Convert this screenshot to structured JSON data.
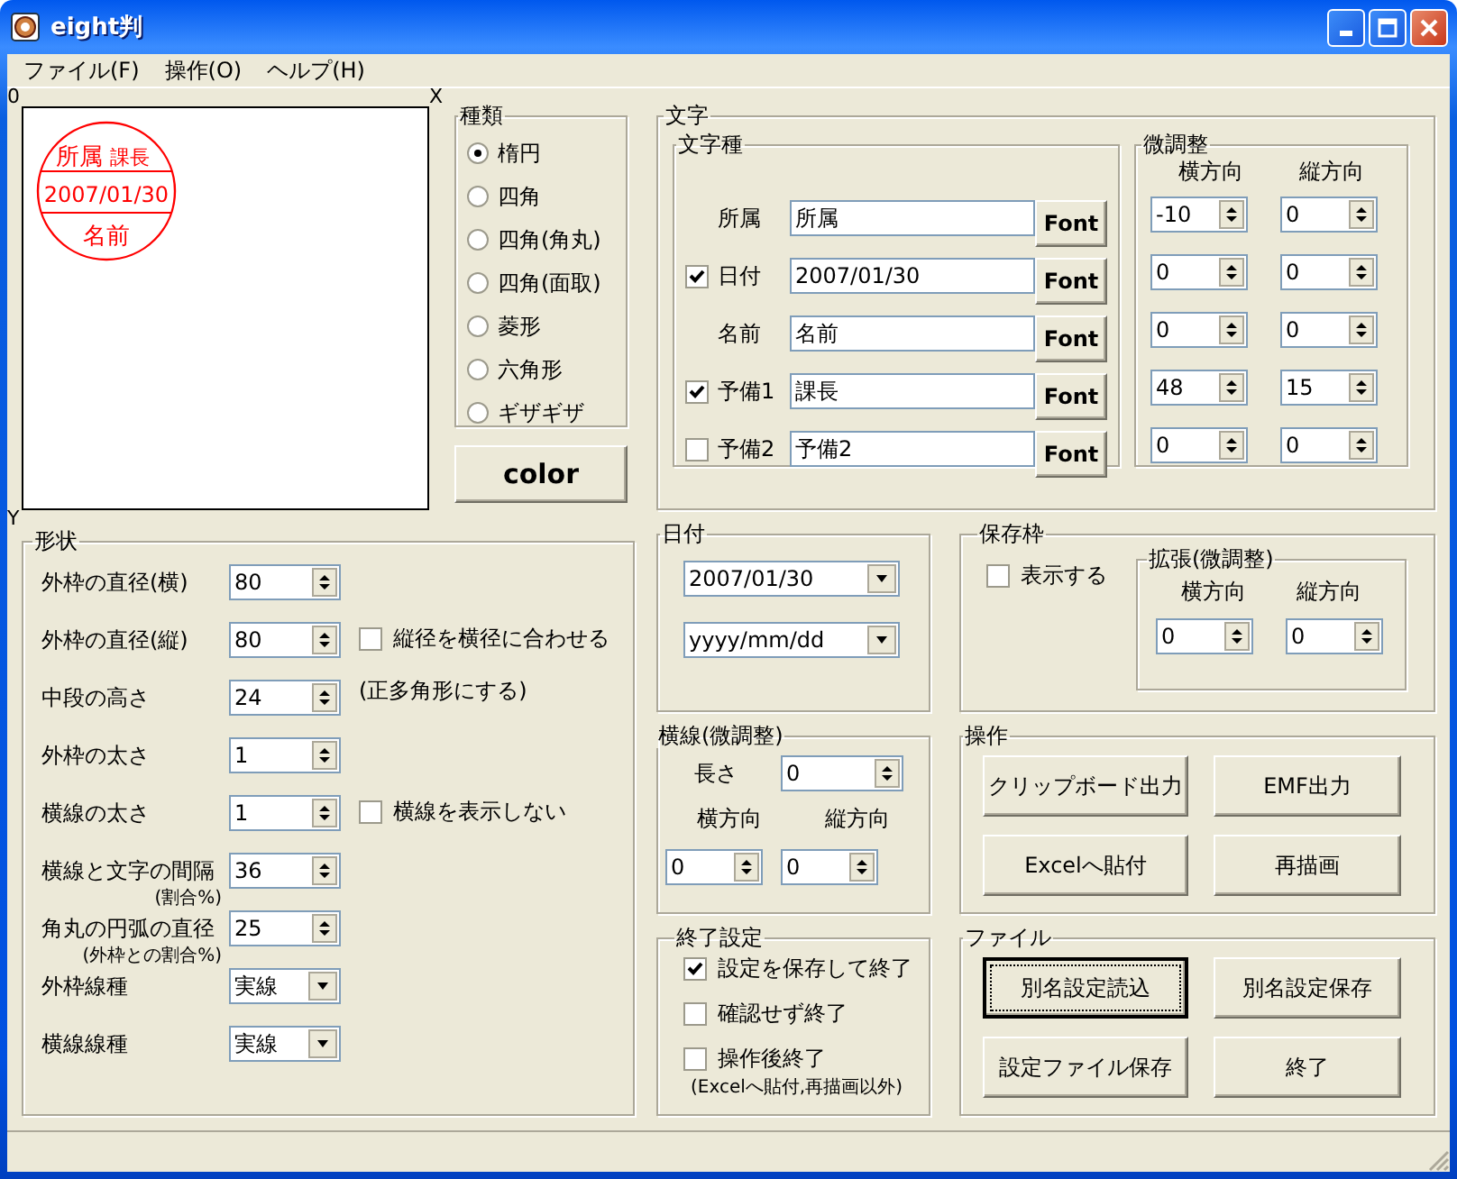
{
  "window": {
    "title": "eight判"
  },
  "menu": [
    "ファイル(F)",
    "操作(O)",
    "ヘルプ(H)"
  ],
  "preview": {
    "origin_label": "0",
    "x_label": "X",
    "y_label": "Y",
    "stamp": {
      "top": "所属",
      "top_extra": "課長",
      "middle": "2007/01/30",
      "bottom": "名前"
    }
  },
  "shape_type": {
    "title": "種類",
    "options": [
      {
        "label": "楕円",
        "selected": true
      },
      {
        "label": "四角",
        "selected": false
      },
      {
        "label": "四角(角丸)",
        "selected": false
      },
      {
        "label": "四角(面取)",
        "selected": false
      },
      {
        "label": "菱形",
        "selected": false
      },
      {
        "label": "六角形",
        "selected": false
      },
      {
        "label": "ギザギザ",
        "selected": false
      }
    ]
  },
  "color_button": "color",
  "shape": {
    "title": "形状",
    "rows": [
      {
        "kind": "spin",
        "label": "外枠の直径(横)",
        "value": "80"
      },
      {
        "kind": "spin",
        "label": "外枠の直径(縦)",
        "value": "80",
        "checkbox": {
          "label": "縦径を横径に合わせる",
          "checked": false
        },
        "note": "(正多角形にする)"
      },
      {
        "kind": "spin",
        "label": "中段の高さ",
        "value": "24"
      },
      {
        "kind": "spin",
        "label": "外枠の太さ",
        "value": "1"
      },
      {
        "kind": "spin",
        "label": "横線の太さ",
        "value": "1",
        "checkbox": {
          "label": "横線を表示しない",
          "checked": false
        }
      },
      {
        "kind": "spin",
        "label": "横線と文字の間隔",
        "sublabel": "(割合%)",
        "value": "36"
      },
      {
        "kind": "spin",
        "label": "角丸の円弧の直径",
        "sublabel": "(外枠との割合%)",
        "value": "25"
      },
      {
        "kind": "dropdown",
        "label": "外枠線種",
        "value": "実線"
      },
      {
        "kind": "dropdown",
        "label": "横線線種",
        "value": "実線"
      }
    ]
  },
  "text": {
    "title": "文字",
    "kinds": {
      "title": "文字種",
      "rows": [
        {
          "kind": "label",
          "label": "所属",
          "value": "所属",
          "font_button": "Font"
        },
        {
          "kind": "checkbox",
          "label": "日付",
          "checked": true,
          "value": "2007/01/30",
          "font_button": "Font"
        },
        {
          "kind": "label",
          "label": "名前",
          "value": "名前",
          "font_button": "Font"
        },
        {
          "kind": "checkbox",
          "label": "予備1",
          "checked": true,
          "value": "課長",
          "font_button": "Font"
        },
        {
          "kind": "checkbox",
          "label": "予備2",
          "checked": false,
          "value": "予備2",
          "font_button": "Font"
        }
      ]
    },
    "adjust": {
      "title": "微調整",
      "columns": [
        "横方向",
        "縦方向"
      ],
      "rows": [
        [
          "-10",
          "0"
        ],
        [
          "0",
          "0"
        ],
        [
          "0",
          "0"
        ],
        [
          "48",
          "15"
        ],
        [
          "0",
          "0"
        ]
      ]
    }
  },
  "date": {
    "title": "日付",
    "dropdowns": [
      "2007/01/30",
      "yyyy/mm/dd"
    ]
  },
  "save_frame": {
    "title": "保存枠",
    "checkbox": {
      "label": "表示する",
      "checked": false
    },
    "expand": {
      "title": "拡張(微調整)",
      "columns": [
        "横方向",
        "縦方向"
      ],
      "values": [
        "0",
        "0"
      ]
    }
  },
  "line_adjust": {
    "title": "横線(微調整)",
    "length_label": "長さ",
    "length": "0",
    "columns": [
      "横方向",
      "縦方向"
    ],
    "values": [
      "0",
      "0"
    ]
  },
  "operations": {
    "title": "操作",
    "buttons": [
      {
        "label": "クリップボード出力",
        "focused": false
      },
      {
        "label": "EMF出力",
        "focused": false
      },
      {
        "label": "Excelへ貼付",
        "focused": false
      },
      {
        "label": "再描画",
        "focused": false
      }
    ]
  },
  "exit_settings": {
    "title": "終了設定",
    "options": [
      {
        "label": "設定を保存して終了",
        "checked": true
      },
      {
        "label": "確認せず終了",
        "checked": false
      },
      {
        "label": "操作後終了",
        "checked": false,
        "note": "(Excelへ貼付,再描画以外)"
      }
    ]
  },
  "file": {
    "title": "ファイル",
    "buttons": [
      {
        "label": "別名設定読込",
        "focused": true
      },
      {
        "label": "別名設定保存",
        "focused": false
      },
      {
        "label": "設定ファイル保存",
        "focused": false
      },
      {
        "label": "終了",
        "focused": false
      }
    ]
  }
}
